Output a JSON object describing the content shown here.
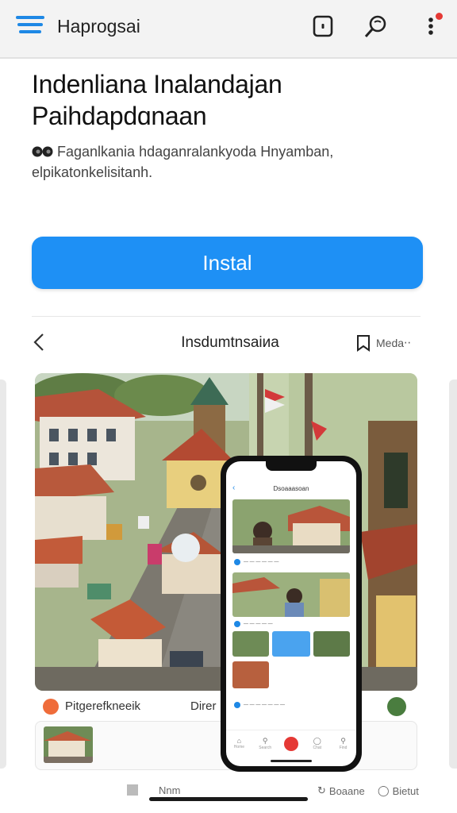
{
  "topbar": {
    "title": "Haprogsai",
    "icons": [
      "menu-icon",
      "tablet-icon",
      "search-icon",
      "more-vert-icon"
    ],
    "accent": "#1e88e5",
    "badge_color": "#e53935"
  },
  "hero": {
    "headline_line1": "Indenliana Inalandajan",
    "headline_line2": "Paihdapdɑnaan",
    "description": "Faganlkania hdaganralankyoda Hnyamban, elpikatonkelisitanh."
  },
  "install": {
    "label": "Instal",
    "color": "#1e90f5"
  },
  "gallery": {
    "title": "Inѕdumtnsaiиa",
    "bookmark_label": "Meda‧‧"
  },
  "screenshot_caption": {
    "left_label": "Pitgerefkneeik",
    "right_label": "Direr"
  },
  "phone": {
    "title": "Dsoaaasoan",
    "nav": [
      {
        "icon": "home-icon",
        "label": "Home"
      },
      {
        "icon": "search-icon",
        "label": "Search"
      },
      {
        "icon": "record-icon",
        "label": ""
      },
      {
        "icon": "chat-icon",
        "label": "Chat"
      },
      {
        "icon": "search-icon",
        "label": "Find"
      }
    ]
  },
  "bottom_nav": {
    "item1": "Nnm",
    "item2": "Boaane",
    "item3": "Bietut"
  }
}
